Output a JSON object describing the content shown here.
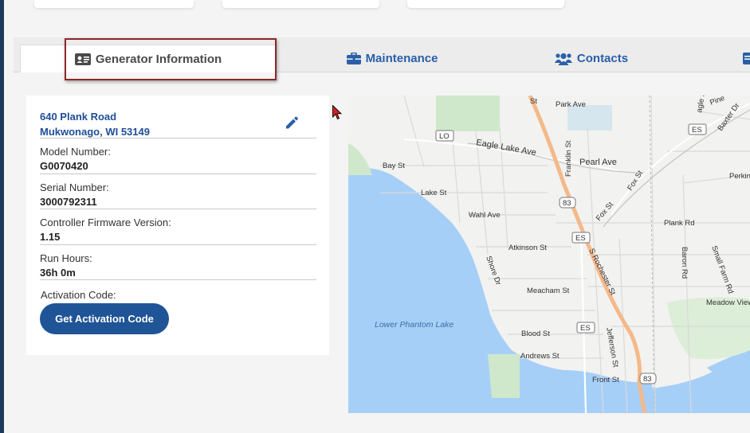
{
  "tabs": {
    "generator_info": "Generator Information",
    "maintenance": "Maintenance",
    "contacts": "Contacts"
  },
  "address": {
    "line1": "640 Plank Road",
    "line2": "Mukwonago, WI 53149"
  },
  "fields": {
    "model_label": "Model Number:",
    "model_value": "G0070420",
    "serial_label": "Serial Number:",
    "serial_value": "3000792311",
    "firmware_label": "Controller Firmware Version:",
    "firmware_value": "1.15",
    "hours_label": "Run Hours:",
    "hours_value": "36h 0m"
  },
  "activation": {
    "label": "Activation Code:",
    "button": "Get Activation Code"
  },
  "map": {
    "streets": {
      "park_ave": "Park Ave",
      "eagle_lake_ave": "Eagle Lake Ave",
      "pearl_ave": "Pearl Ave",
      "bay_st": "Bay St",
      "lake_st": "Lake St",
      "franklin_st": "Franklin St",
      "fox_st_a": "Fox St",
      "fox_st_b": "Fox St",
      "wahl_ave": "Wahl Ave",
      "plank_rd": "Plank Rd",
      "atkinson_st": "Atkinson St",
      "shore_dr": "Shore Dr",
      "s_rochester_st": "S Rochester St",
      "baron_rd": "Baron Rd",
      "small_farm_rd": "Small Farm Rd",
      "meacham_st": "Meacham St",
      "meadow_view": "Meadow View",
      "blood_st": "Blood St",
      "jefferson_st": "Jefferson St",
      "andrews_st": "Andrews St",
      "front_st": "Front St",
      "st_top": "St",
      "baxter_dr": "Baxter Dr",
      "perkins": "Perkins",
      "pine": "Pine",
      "eagle_top": "agle St"
    },
    "lake_name": "Lower Phantom Lake",
    "shields": {
      "lo": "LO",
      "es1": "ES",
      "es2": "ES",
      "es3": "ES",
      "hw83a": "83",
      "hw83b": "83"
    }
  }
}
